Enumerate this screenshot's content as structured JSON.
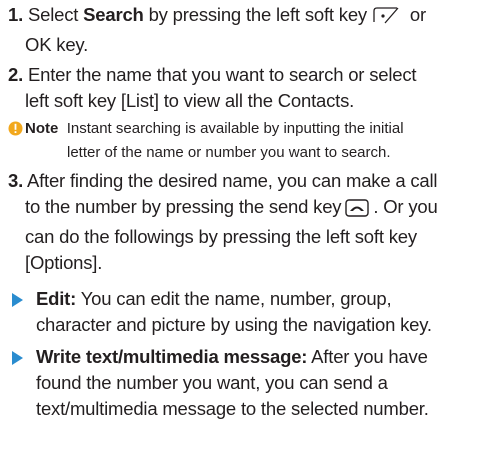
{
  "accent_color": "#2a8ccf",
  "steps": [
    {
      "number": "1.",
      "lines": [
        {
          "pre": " Select ",
          "bold": "Search",
          "post": " by pressing the left soft key",
          "icon": "left-soft-key-icon",
          "after": " or"
        },
        {
          "text": "OK key."
        }
      ]
    },
    {
      "number": "2.",
      "lines": [
        {
          "text": " Enter the name that you want to search or select"
        },
        {
          "text": "left soft key [List] to view all the Contacts."
        }
      ]
    },
    {
      "number": "3.",
      "lines": [
        {
          "text": " After finding the desired name, you can make a call"
        },
        {
          "pre": "to the number by pressing the send key",
          "icon": "send-key-icon",
          "after": ". Or you"
        },
        {
          "text": "can do the followings by pressing the left soft key"
        },
        {
          "text": "[Options]."
        }
      ]
    }
  ],
  "note": {
    "icon": "info-icon",
    "label": "Note",
    "line1": "Instant searching is available by inputting the initial",
    "line2": "letter of the name or number you want to search."
  },
  "bullets": [
    {
      "title": "Edit:",
      "line1": " You can edit the name, number, group,",
      "line2": "character and picture by using the navigation key."
    },
    {
      "title": "Write text/multimedia message:",
      "line1": " After you have",
      "line2": "found the number you want, you can send a",
      "line3": "text/multimedia message to the selected number."
    }
  ]
}
